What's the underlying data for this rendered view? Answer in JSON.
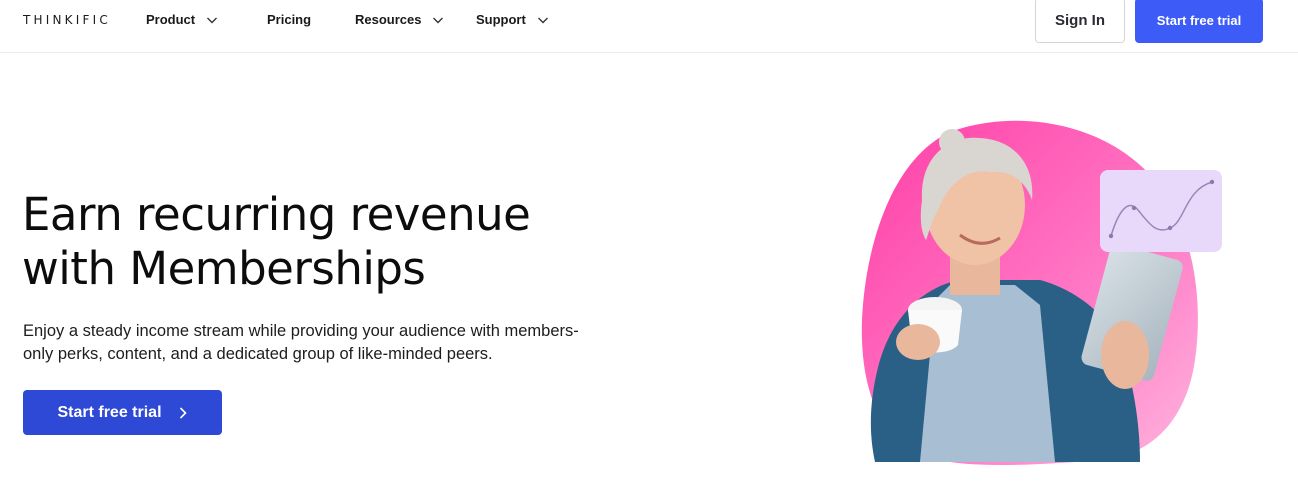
{
  "header": {
    "logo": "THINKIFIC",
    "nav": [
      {
        "label": "Product",
        "has_dropdown": true
      },
      {
        "label": "Pricing",
        "has_dropdown": false
      },
      {
        "label": "Resources",
        "has_dropdown": true
      },
      {
        "label": "Support",
        "has_dropdown": true
      }
    ],
    "sign_in_label": "Sign In",
    "start_trial_label": "Start free trial"
  },
  "hero": {
    "title_line1": "Earn recurring revenue",
    "title_line2": "with Memberships",
    "subtitle_line1": "Enjoy a steady income stream while providing your audience with members-",
    "subtitle_line2": "only perks, content, and a dedicated group of like-minded peers.",
    "cta_label": "Start free trial"
  },
  "colors": {
    "primary": "#3d5bf6",
    "cta": "#2d49d6",
    "blob_pink": "#ff4fae",
    "card_lavender": "#e8d9fb"
  },
  "icons": {
    "nav_dropdown": "chevron-down-icon",
    "cta_arrow": "chevron-right-icon"
  }
}
